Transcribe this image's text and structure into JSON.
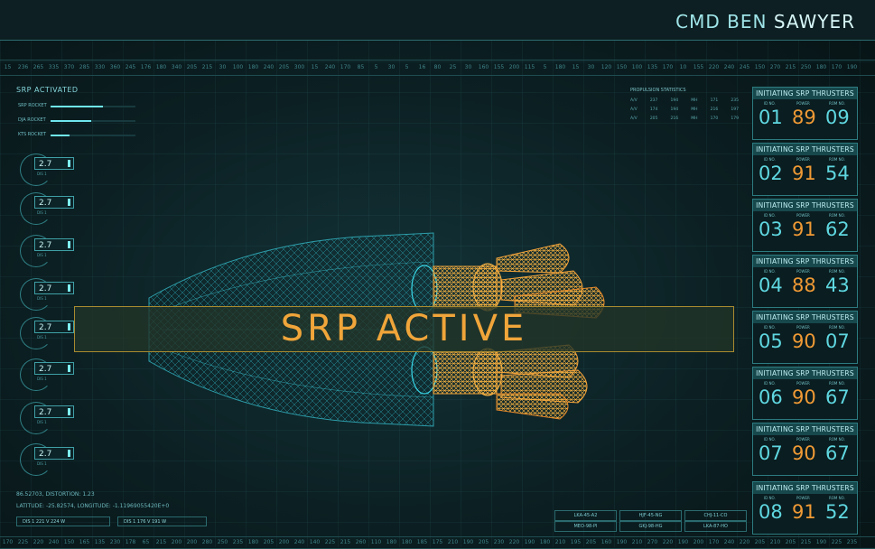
{
  "header": {
    "cmd_prefix": "CMD BEN ",
    "cmd_name": "SAWYER"
  },
  "ruler_top": [
    "15",
    "236",
    "265",
    "335",
    "370",
    "285",
    "330",
    "360",
    "245",
    "176",
    "180",
    "340",
    "205",
    "215",
    "30",
    "100",
    "180",
    "240",
    "205",
    "300",
    "15",
    "240",
    "170",
    "85",
    "5",
    "30",
    "5",
    "16",
    "80",
    "25",
    "30",
    "160",
    "155",
    "200",
    "115",
    "5",
    "180",
    "15",
    "30",
    "120",
    "150",
    "100",
    "135",
    "170",
    "10",
    "155",
    "220",
    "240",
    "245",
    "150",
    "270",
    "215",
    "250",
    "180",
    "170",
    "190"
  ],
  "ruler_bottom": [
    "170",
    "225",
    "220",
    "240",
    "150",
    "165",
    "135",
    "230",
    "178",
    "65",
    "215",
    "200",
    "200",
    "280",
    "250",
    "235",
    "180",
    "205",
    "200",
    "240",
    "140",
    "225",
    "215",
    "260",
    "110",
    "180",
    "180",
    "185",
    "175",
    "210",
    "190",
    "205",
    "230",
    "220",
    "190",
    "180",
    "210",
    "195",
    "205",
    "160",
    "190",
    "210",
    "270",
    "220",
    "190",
    "200",
    "170",
    "240",
    "220",
    "205",
    "210",
    "205",
    "215",
    "190",
    "225",
    "235"
  ],
  "left_status": {
    "title": "SRP ACTIVATED",
    "rockets": [
      {
        "label": "SRP ROCKET",
        "level": 0.62
      },
      {
        "label": "DJA ROCKET",
        "level": 0.48
      },
      {
        "label": "KTS ROCKET",
        "level": 0.22
      }
    ]
  },
  "gauges": [
    {
      "value": "2.7",
      "sub": "DIS 1"
    },
    {
      "value": "2.7",
      "sub": "DIS 1"
    },
    {
      "value": "2.7",
      "sub": "DIS 1"
    },
    {
      "value": "2.7",
      "sub": "DIS 1"
    },
    {
      "value": "2.7",
      "sub": "DIS 1"
    },
    {
      "value": "2.7",
      "sub": "DIS 1"
    },
    {
      "value": "2.7",
      "sub": "DIS 1"
    },
    {
      "value": "2.7",
      "sub": "DIS 1"
    }
  ],
  "propulsion": {
    "title": "PROPULSION STATISTICS",
    "rows": [
      [
        "A/V",
        "237",
        "194",
        "MH",
        "171",
        "235"
      ],
      [
        "A/V",
        "174",
        "194",
        "MH",
        "216",
        "197"
      ],
      [
        "A/V",
        "205",
        "216",
        "MH",
        "170",
        "179"
      ]
    ]
  },
  "banner": {
    "text": "SRP ACTIVE"
  },
  "thrusters": [
    {
      "title": "INITIATING SRP THRUSTERS",
      "id": "01",
      "power": "89",
      "rom": "09"
    },
    {
      "title": "INITIATING SRP THRUSTERS",
      "id": "02",
      "power": "91",
      "rom": "54"
    },
    {
      "title": "INITIATING SRP THRUSTERS",
      "id": "03",
      "power": "91",
      "rom": "62"
    },
    {
      "title": "INITIATING SRP THRUSTERS",
      "id": "04",
      "power": "88",
      "rom": "43"
    },
    {
      "title": "INITIATING SRP THRUSTERS",
      "id": "05",
      "power": "90",
      "rom": "07"
    },
    {
      "title": "INITIATING SRP THRUSTERS",
      "id": "06",
      "power": "90",
      "rom": "67"
    },
    {
      "title": "INITIATING SRP THRUSTERS",
      "id": "07",
      "power": "90",
      "rom": "67"
    },
    {
      "title": "INITIATING SRP THRUSTERS",
      "id": "08",
      "power": "91",
      "rom": "52"
    }
  ],
  "thruster_labels": {
    "id": "ID NO.",
    "power": "POWER",
    "rom": "ROM NO."
  },
  "coords": {
    "line1": "86.52703, DISTORTION: 1.23",
    "line2": "LATITUDE: -25.82574, LONGITUDE: -1.11969055420E+0"
  },
  "dis_boxes": [
    {
      "text": "DIS  1    221   V  224  W"
    },
    {
      "text": "DIS  1    176   V  191  W"
    }
  ],
  "codes": [
    "LKA-45-A2",
    "HJF-45-NG",
    "CHJ-11-CO",
    "MEO-98-PI",
    "GKJ-98-HG",
    "LKA-87-HO"
  ],
  "colors": {
    "accent": "#6fe6ee",
    "orange": "#f09a35",
    "banner_border": "#a98a2f"
  }
}
